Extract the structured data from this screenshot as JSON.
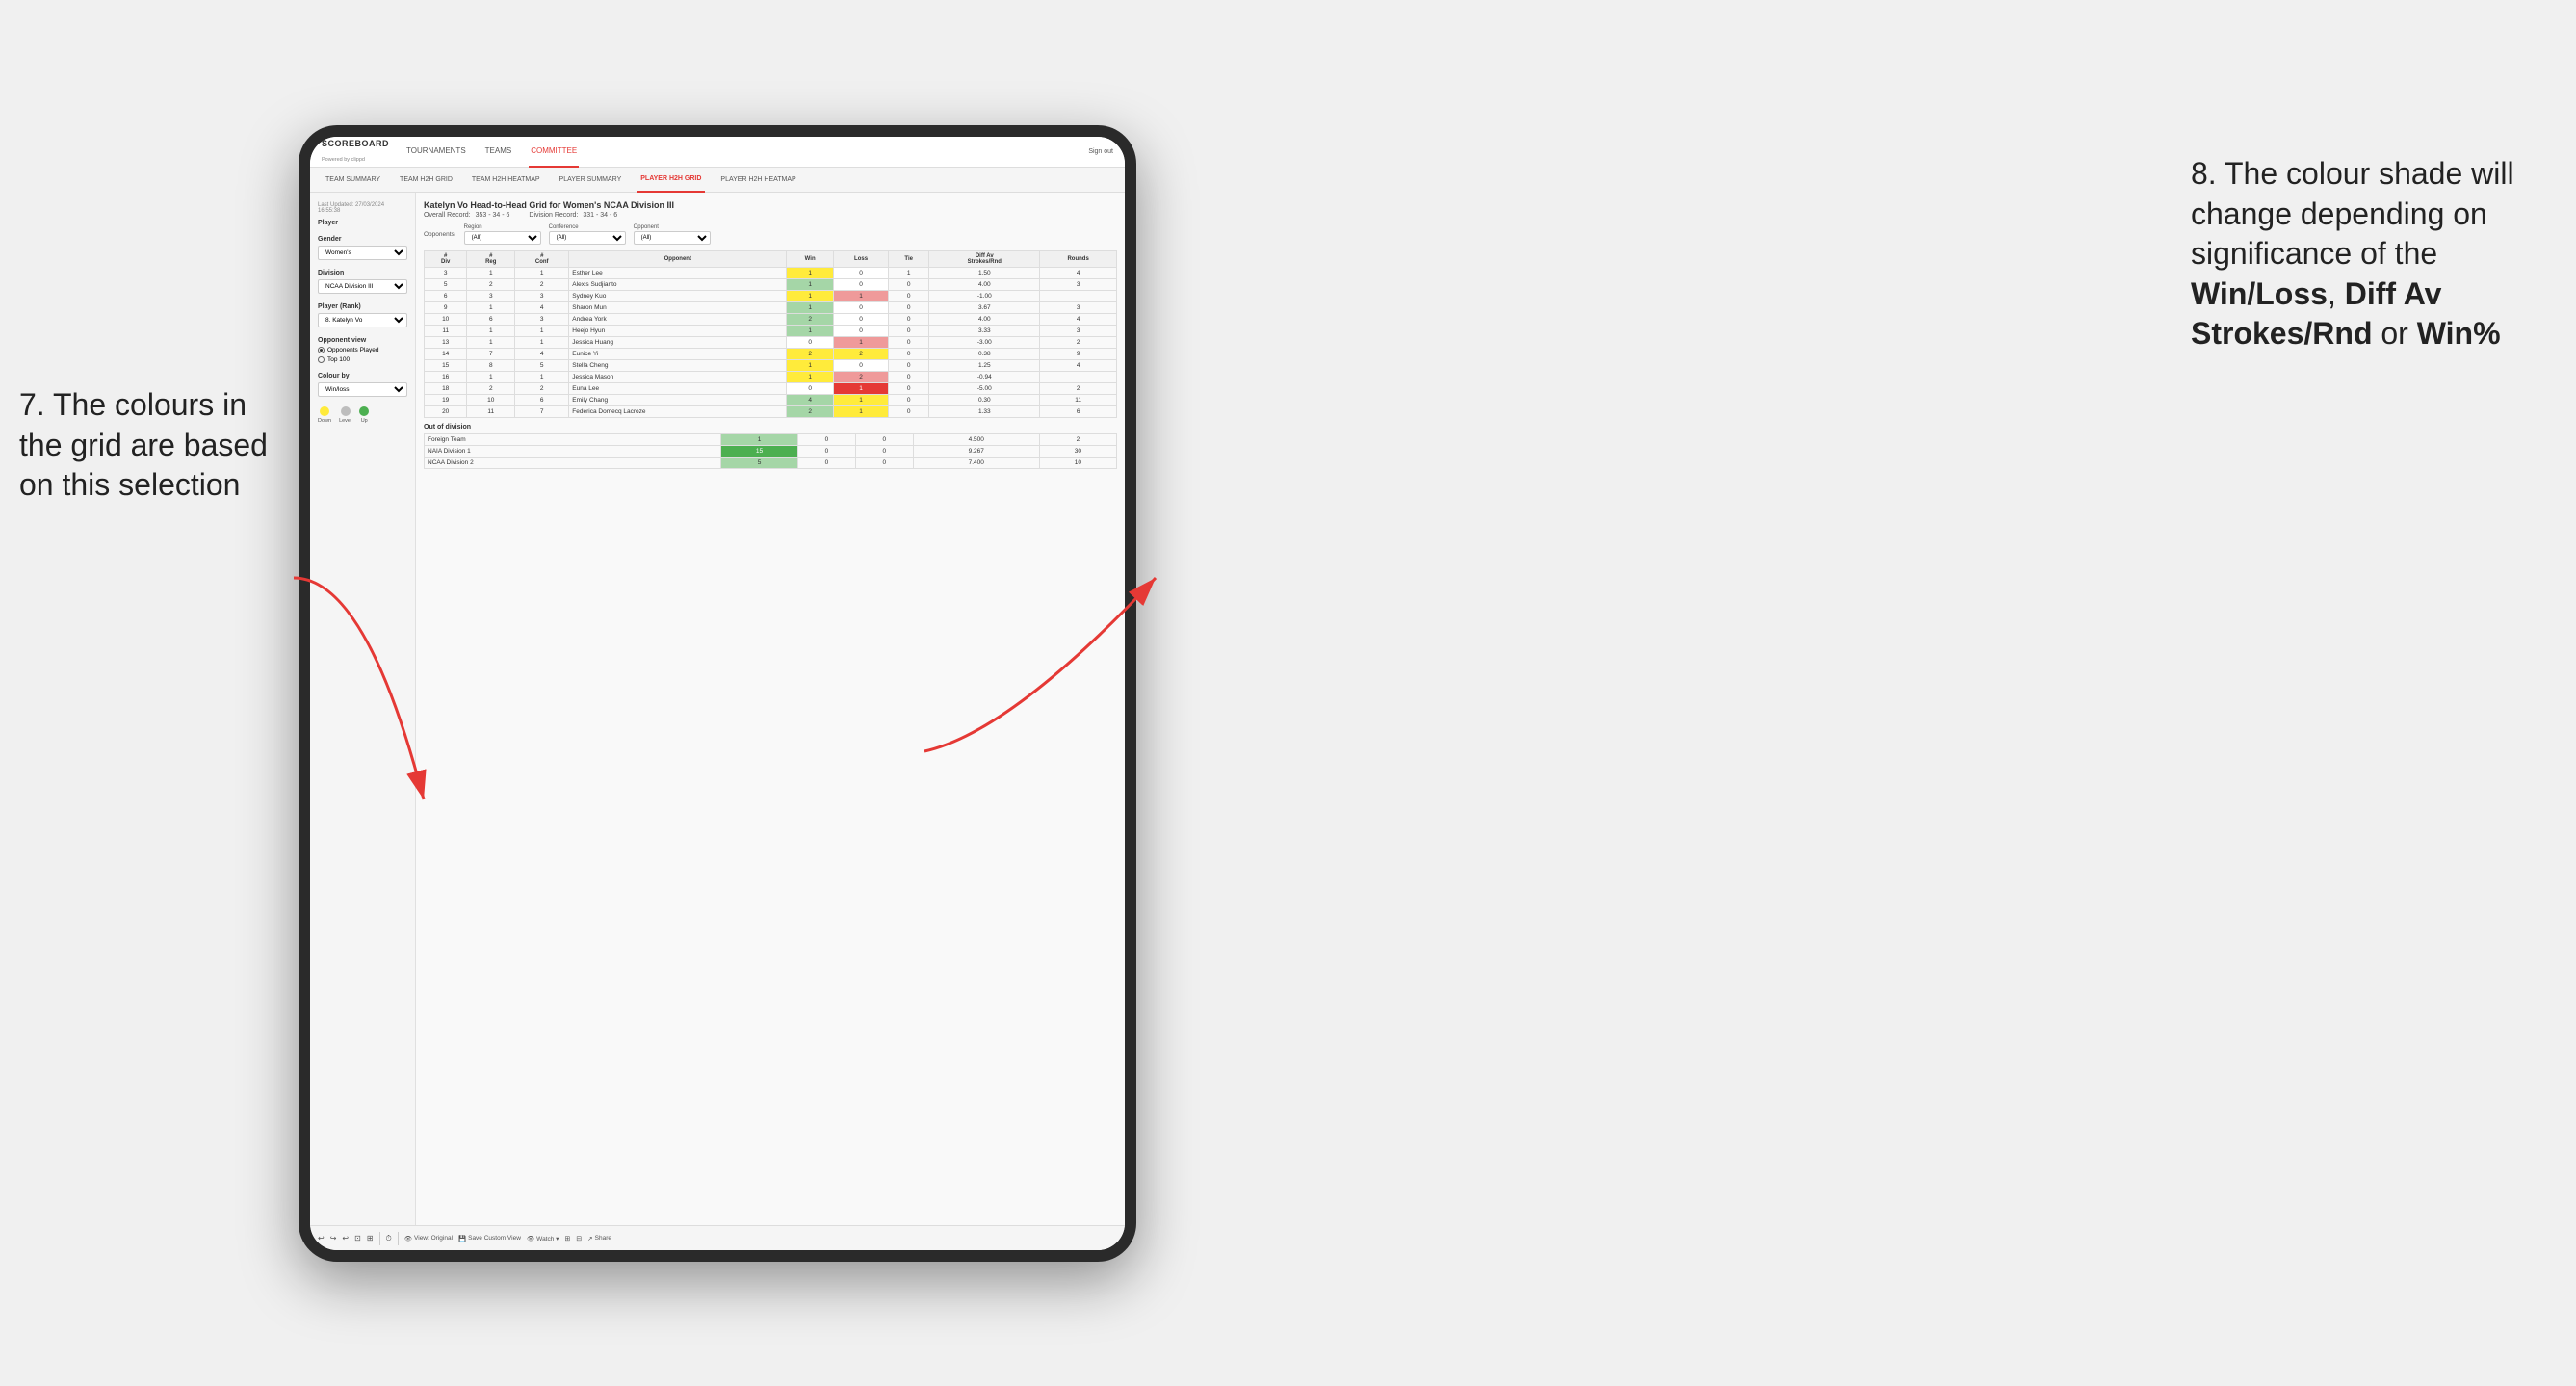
{
  "annotations": {
    "left_title": "7. The colours in the grid are based on this selection",
    "right_title": "8. The colour shade will change depending on significance of the",
    "right_bold1": "Win/Loss",
    "right_comma": ", ",
    "right_bold2": "Diff Av Strokes/Rnd",
    "right_or": " or ",
    "right_bold3": "Win%"
  },
  "navbar": {
    "logo": "SCOREBOARD",
    "logo_sub": "Powered by clippd",
    "items": [
      "TOURNAMENTS",
      "TEAMS",
      "COMMITTEE"
    ],
    "active_item": "COMMITTEE",
    "right": "Sign out"
  },
  "subnav": {
    "items": [
      "TEAM SUMMARY",
      "TEAM H2H GRID",
      "TEAM H2H HEATMAP",
      "PLAYER SUMMARY",
      "PLAYER H2H GRID",
      "PLAYER H2H HEATMAP"
    ],
    "active_item": "PLAYER H2H GRID"
  },
  "sidebar": {
    "timestamp": "Last Updated: 27/03/2024 16:55:38",
    "player_label": "Player",
    "gender_label": "Gender",
    "gender_value": "Women's",
    "division_label": "Division",
    "division_value": "NCAA Division III",
    "player_rank_label": "Player (Rank)",
    "player_rank_value": "8. Katelyn Vo",
    "opponent_view_label": "Opponent view",
    "opponent_played": "Opponents Played",
    "opponent_top100": "Top 100",
    "colour_by_label": "Colour by",
    "colour_by_value": "Win/loss",
    "legend": {
      "down": "Down",
      "level": "Level",
      "up": "Up"
    }
  },
  "grid": {
    "title": "Katelyn Vo Head-to-Head Grid for Women's NCAA Division III",
    "overall_record_label": "Overall Record:",
    "overall_record": "353 - 34 - 6",
    "division_record_label": "Division Record:",
    "division_record": "331 - 34 - 6",
    "filters": {
      "region_label": "Region",
      "region_value": "(All)",
      "conference_label": "Conference",
      "conference_value": "(All)",
      "opponent_label": "Opponent",
      "opponent_value": "(All)"
    },
    "opponents_label": "Opponents:",
    "table_headers": {
      "div": "#\nDiv",
      "reg": "#\nReg",
      "conf": "#\nConf",
      "opponent": "Opponent",
      "win": "Win",
      "loss": "Loss",
      "tie": "Tie",
      "diff_av": "Diff Av\nStrokes/Rnd",
      "rounds": "Rounds"
    },
    "rows": [
      {
        "div": "3",
        "reg": "1",
        "conf": "1",
        "opponent": "Esther Lee",
        "win": 1,
        "loss": 0,
        "tie": 1,
        "diff": "1.50",
        "rounds": "4",
        "win_color": "yellow",
        "loss_color": "white"
      },
      {
        "div": "5",
        "reg": "2",
        "conf": "2",
        "opponent": "Alexis Sudjianto",
        "win": 1,
        "loss": 0,
        "tie": 0,
        "diff": "4.00",
        "rounds": "3",
        "win_color": "green-light",
        "loss_color": "white"
      },
      {
        "div": "6",
        "reg": "3",
        "conf": "3",
        "opponent": "Sydney Kuo",
        "win": 1,
        "loss": 1,
        "tie": 0,
        "diff": "-1.00",
        "rounds": "",
        "win_color": "yellow",
        "loss_color": "red-light"
      },
      {
        "div": "9",
        "reg": "1",
        "conf": "4",
        "opponent": "Sharon Mun",
        "win": 1,
        "loss": 0,
        "tie": 0,
        "diff": "3.67",
        "rounds": "3",
        "win_color": "green-light",
        "loss_color": "white"
      },
      {
        "div": "10",
        "reg": "6",
        "conf": "3",
        "opponent": "Andrea York",
        "win": 2,
        "loss": 0,
        "tie": 0,
        "diff": "4.00",
        "rounds": "4",
        "win_color": "green-light",
        "loss_color": "white"
      },
      {
        "div": "11",
        "reg": "1",
        "conf": "1",
        "opponent": "Heejo Hyun",
        "win": 1,
        "loss": 0,
        "tie": 0,
        "diff": "3.33",
        "rounds": "3",
        "win_color": "green-light",
        "loss_color": "white"
      },
      {
        "div": "13",
        "reg": "1",
        "conf": "1",
        "opponent": "Jessica Huang",
        "win": 0,
        "loss": 1,
        "tie": 0,
        "diff": "-3.00",
        "rounds": "2",
        "win_color": "white",
        "loss_color": "red-light"
      },
      {
        "div": "14",
        "reg": "7",
        "conf": "4",
        "opponent": "Eunice Yi",
        "win": 2,
        "loss": 2,
        "tie": 0,
        "diff": "0.38",
        "rounds": "9",
        "win_color": "yellow",
        "loss_color": "yellow"
      },
      {
        "div": "15",
        "reg": "8",
        "conf": "5",
        "opponent": "Stella Cheng",
        "win": 1,
        "loss": 0,
        "tie": 0,
        "diff": "1.25",
        "rounds": "4",
        "win_color": "yellow",
        "loss_color": "white"
      },
      {
        "div": "16",
        "reg": "1",
        "conf": "1",
        "opponent": "Jessica Mason",
        "win": 1,
        "loss": 2,
        "tie": 0,
        "diff": "-0.94",
        "rounds": "",
        "win_color": "yellow",
        "loss_color": "red-light"
      },
      {
        "div": "18",
        "reg": "2",
        "conf": "2",
        "opponent": "Euna Lee",
        "win": 0,
        "loss": 1,
        "tie": 0,
        "diff": "-5.00",
        "rounds": "2",
        "win_color": "white",
        "loss_color": "red-dark"
      },
      {
        "div": "19",
        "reg": "10",
        "conf": "6",
        "opponent": "Emily Chang",
        "win": 4,
        "loss": 1,
        "tie": 0,
        "diff": "0.30",
        "rounds": "11",
        "win_color": "green-light",
        "loss_color": "yellow"
      },
      {
        "div": "20",
        "reg": "11",
        "conf": "7",
        "opponent": "Federica Domecq Lacroze",
        "win": 2,
        "loss": 1,
        "tie": 0,
        "diff": "1.33",
        "rounds": "6",
        "win_color": "green-light",
        "loss_color": "yellow"
      }
    ],
    "out_of_division_label": "Out of division",
    "out_of_division_rows": [
      {
        "team": "Foreign Team",
        "win": 1,
        "loss": 0,
        "tie": 0,
        "diff": "4.500",
        "rounds": "2",
        "win_color": "green-light"
      },
      {
        "team": "NAIA Division 1",
        "win": 15,
        "loss": 0,
        "tie": 0,
        "diff": "9.267",
        "rounds": "30",
        "win_color": "green-dark"
      },
      {
        "team": "NCAA Division 2",
        "win": 5,
        "loss": 0,
        "tie": 0,
        "diff": "7.400",
        "rounds": "10",
        "win_color": "green-light"
      }
    ]
  },
  "toolbar": {
    "undo": "↩",
    "redo": "↪",
    "view_original": "View: Original",
    "save_custom": "Save Custom View",
    "watch": "Watch ▾",
    "share": "Share"
  }
}
